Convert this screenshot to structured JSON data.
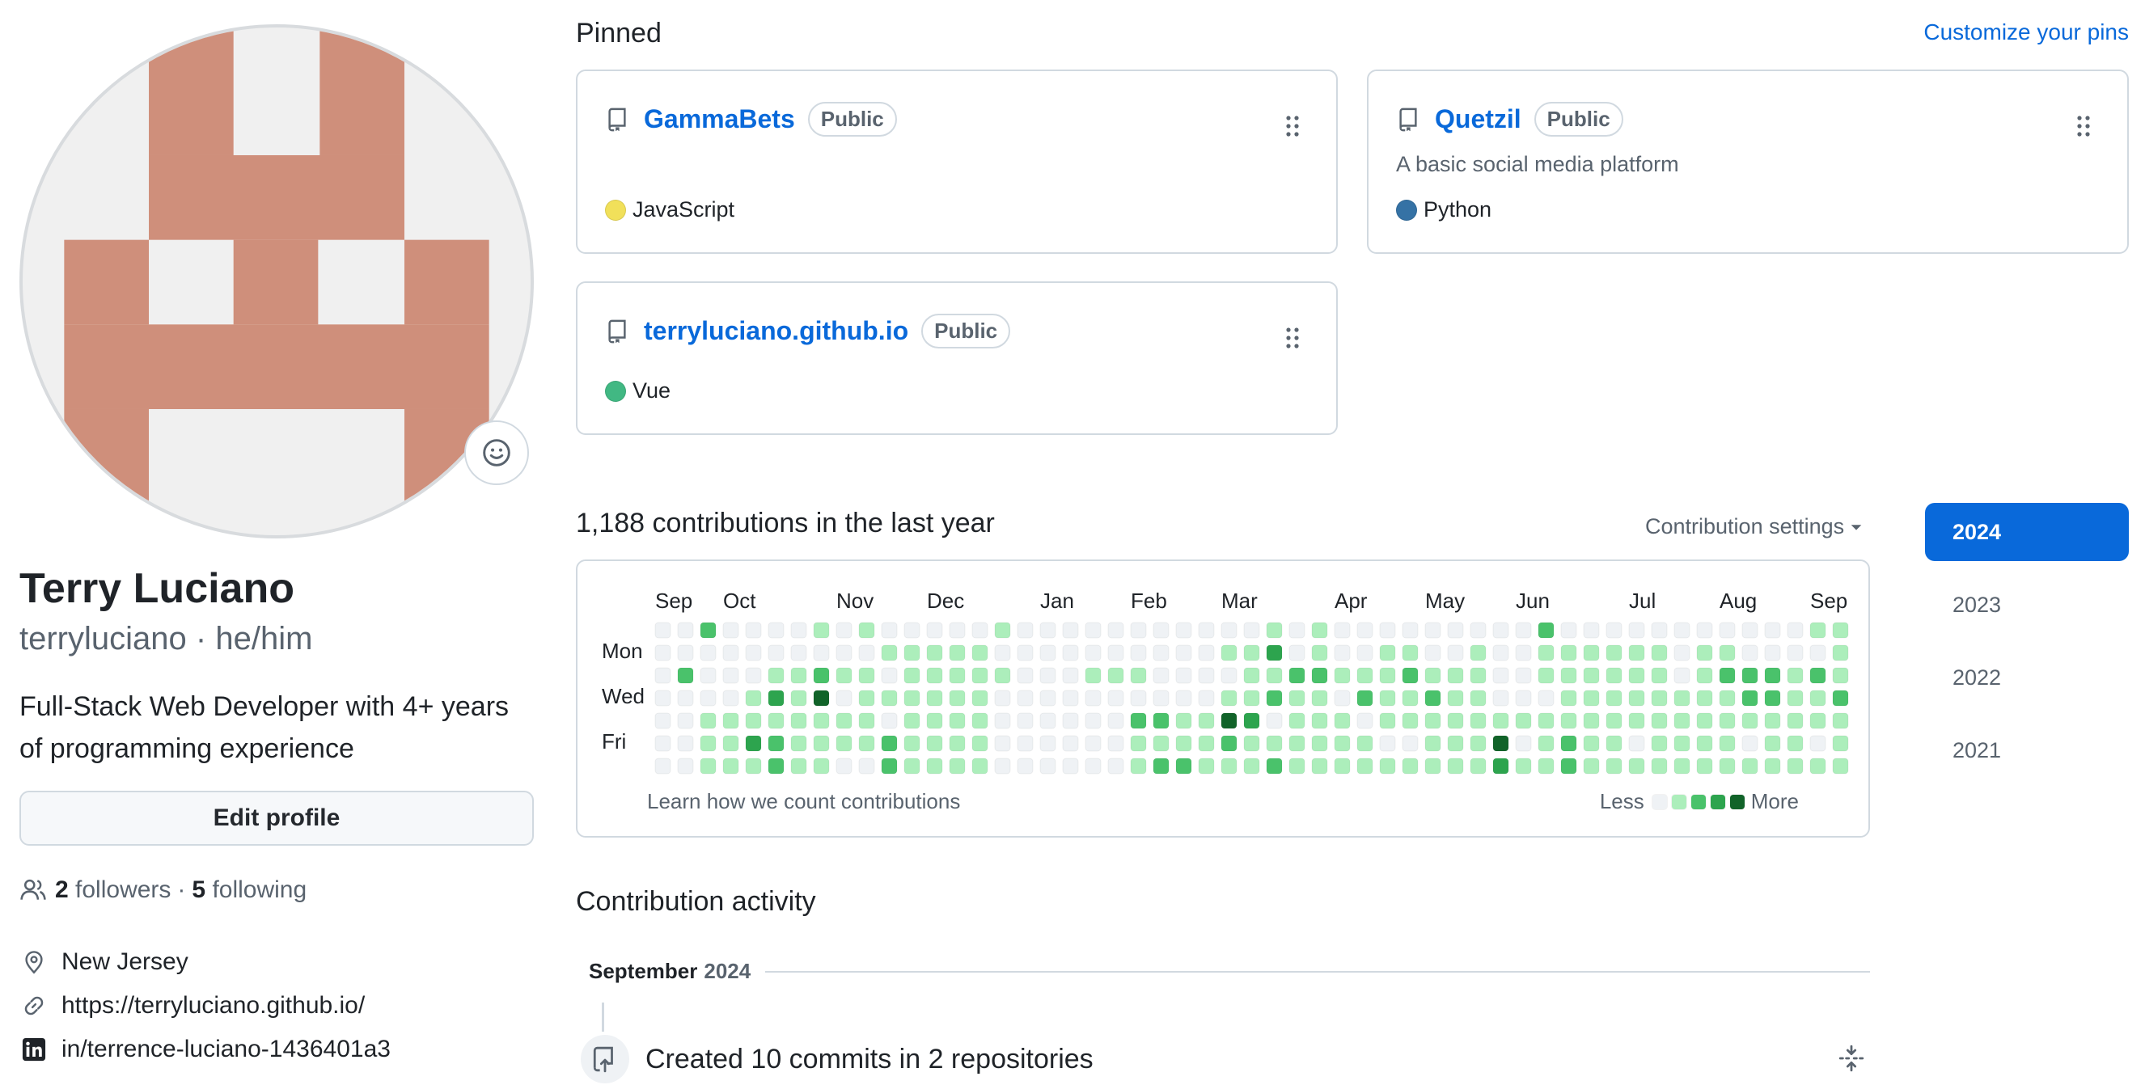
{
  "profile": {
    "full_name": "Terry Luciano",
    "login": "terryluciano",
    "separator": "·",
    "pronouns": "he/him",
    "bio": "Full-Stack Web Developer with 4+ years of programming experience",
    "edit_label": "Edit profile",
    "followers_count": "2",
    "followers_label": "followers",
    "dot": "·",
    "following_count": "5",
    "following_label": "following",
    "location": "New Jersey",
    "website": "https://terryluciano.github.io/",
    "linkedin": "in/terrence-luciano-1436401a3",
    "avatar_color": "#cf8f7b"
  },
  "pinned": {
    "title": "Pinned",
    "customize_label": "Customize your pins",
    "repos": [
      {
        "name": "GammaBets",
        "visibility": "Public",
        "description": "",
        "language": "JavaScript",
        "lang_color": "#f1e05a"
      },
      {
        "name": "Quetzil",
        "visibility": "Public",
        "description": "A basic social media platform",
        "language": "Python",
        "lang_color": "#3572A5"
      },
      {
        "name": "terryluciano.github.io",
        "visibility": "Public",
        "description": "",
        "language": "Vue",
        "lang_color": "#41b883"
      }
    ]
  },
  "contributions": {
    "title": "1,188 contributions in the last year",
    "settings_label": "Contribution settings",
    "months": [
      "Sep",
      "Oct",
      "Nov",
      "Dec",
      "Jan",
      "Feb",
      "Mar",
      "Apr",
      "May",
      "Jun",
      "Jul",
      "Aug",
      "Sep"
    ],
    "month_weeks": [
      0,
      3,
      8,
      12,
      17,
      21,
      25,
      30,
      34,
      38,
      43,
      47,
      51
    ],
    "day_labels": [
      "Mon",
      "Wed",
      "Fri"
    ],
    "learn_label": "Learn how we count contributions",
    "less_label": "Less",
    "more_label": "More",
    "level_colors": [
      "#eff2f5",
      "#aceebb",
      "#4ac26b",
      "#2da44e",
      "#116329"
    ],
    "weeks": 53,
    "grid": [
      "00200001010000010000000000010100000000020000000000011",
      "00000000001111100000000001130100110010011111101100001",
      "02000112110111110001110000112211121110011111101222121",
      "00001314011111100000000001121102112110001111111122112",
      "00111111110111100000022114301110111111111111111111111",
      "00113211112111100000011112111111001114012110111101101",
      "00111211002111100000012211121111111113112111111111111",
      "00000001000001000000000000000000002110000001110101121"
    ]
  },
  "years": [
    "2024",
    "2023",
    "2022",
    "2021"
  ],
  "activity": {
    "title": "Contribution activity",
    "month": "September",
    "year": "2024",
    "commit_summary": "Created 10 commits in 2 repositories"
  }
}
